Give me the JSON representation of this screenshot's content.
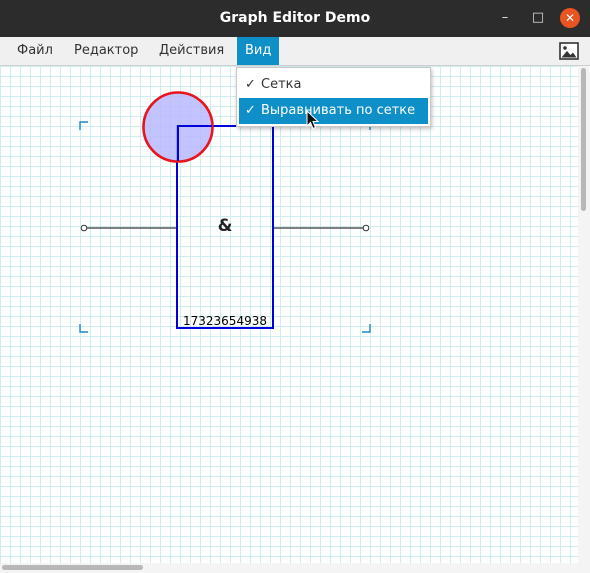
{
  "window": {
    "title": "Graph Editor Demo"
  },
  "menubar": {
    "items": [
      "Файл",
      "Редактор",
      "Действия",
      "Вид"
    ],
    "active": "Вид"
  },
  "view_menu": {
    "items": [
      {
        "check": "✓",
        "label": "Сетка"
      },
      {
        "check": "✓",
        "label": "Выравнивать по сетке"
      }
    ]
  },
  "canvas": {
    "node": {
      "symbol": "&",
      "label": "17323654938"
    }
  },
  "colors": {
    "accent": "#0f8fc8",
    "titlebar": "#2c2c2c",
    "close_button": "#e95420",
    "node_border": "#0000dd",
    "circle_border": "#e8141e",
    "circle_fill": "#b8b8ff",
    "grid": "#cfeef2",
    "selection_corners": "#1b8ac2"
  },
  "icons": [
    "minimize-icon",
    "maximize-icon",
    "close-icon",
    "image-icon",
    "check-icon",
    "mouse-cursor-icon"
  ]
}
